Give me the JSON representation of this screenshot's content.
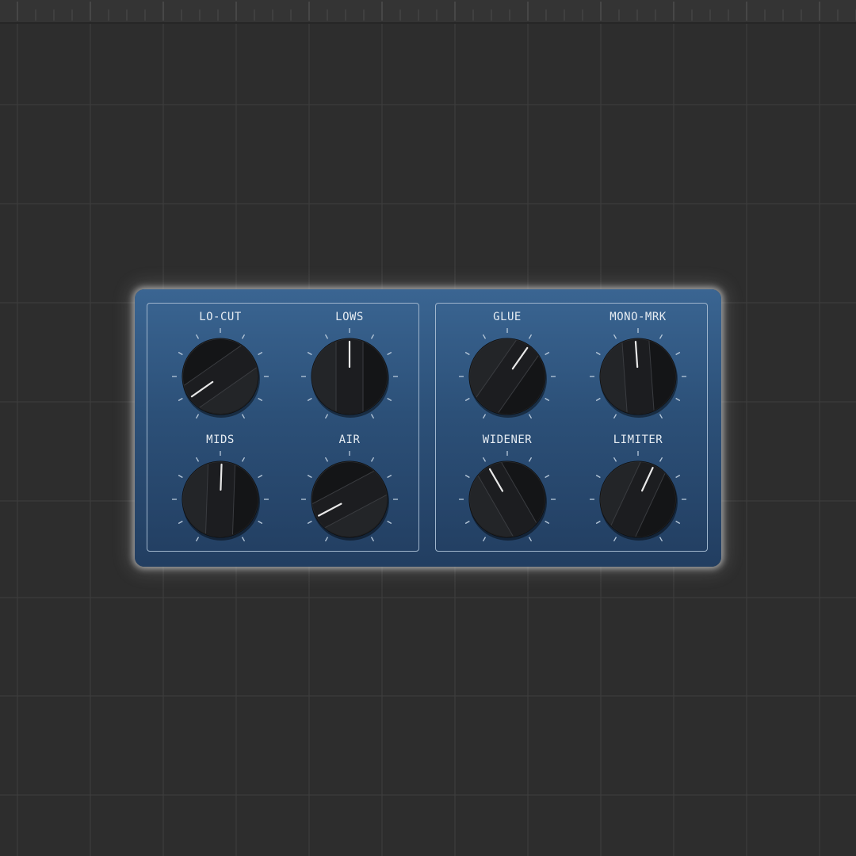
{
  "colors": {
    "workspace_bg": "#2d2d2d",
    "grid_line": "#3f3f3f",
    "panel_top": "#3a6592",
    "panel_bottom": "#223e61",
    "section_border": "#9fb5cc",
    "knob_body": "#1b1c1e",
    "pointer": "#e8e8e8",
    "tick": "#b8c9da"
  },
  "sections": [
    {
      "name": "left",
      "knobs": [
        {
          "label": "LO-CUT",
          "angle_deg": -125
        },
        {
          "label": "LOWS",
          "angle_deg": 0
        },
        {
          "label": "MIDS",
          "angle_deg": 2
        },
        {
          "label": "AIR",
          "angle_deg": -118
        }
      ]
    },
    {
      "name": "right",
      "knobs": [
        {
          "label": "GLUE",
          "angle_deg": 35
        },
        {
          "label": "MONO-MRK",
          "angle_deg": -4
        },
        {
          "label": "WIDENER",
          "angle_deg": -30
        },
        {
          "label": "LIMITER",
          "angle_deg": 25
        }
      ]
    }
  ]
}
